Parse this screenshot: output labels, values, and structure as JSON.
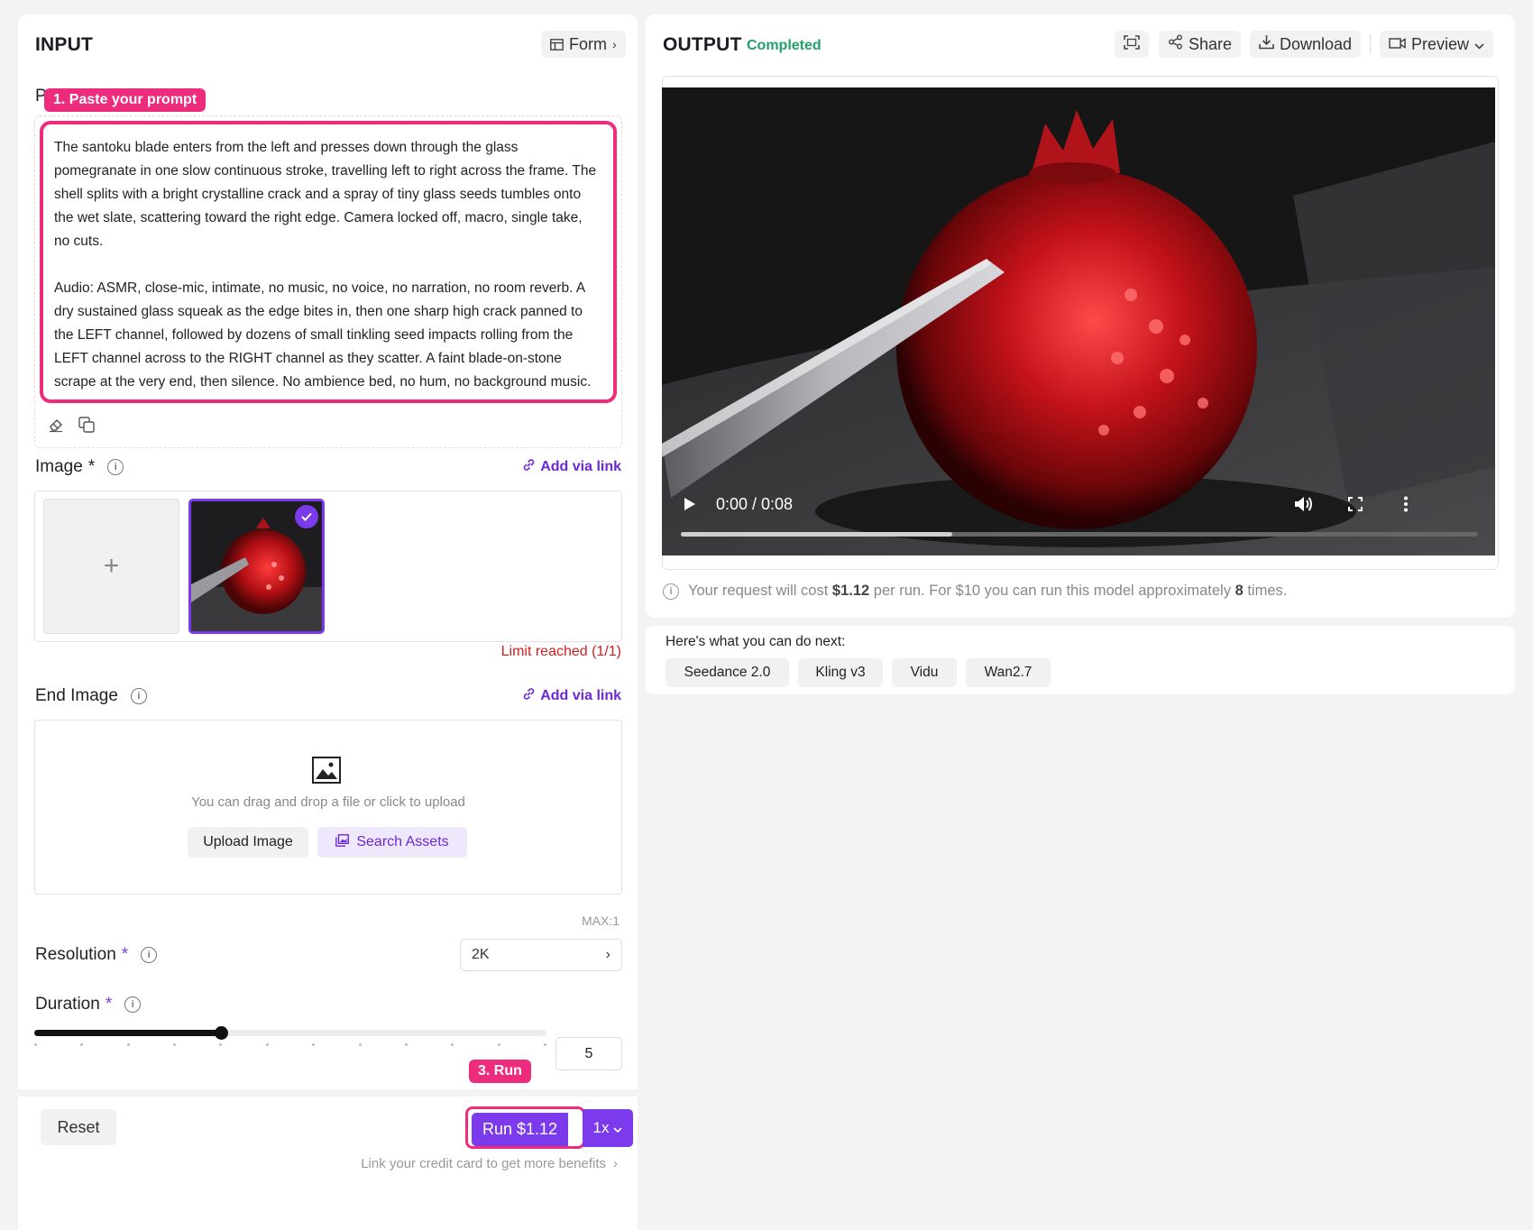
{
  "input": {
    "title": "INPUT",
    "form_button": "Form",
    "prompt_label_initial": "P",
    "prompt_tag": "1. Paste your prompt",
    "prompt_text": "The santoku blade enters from the left and presses down through the glass pomegranate in one slow continuous stroke, travelling left to right across the frame. The shell splits with a bright crystalline crack and a spray of tiny glass seeds tumbles onto the wet slate, scattering toward the right edge. Camera locked off, macro, single take, no cuts.\n\nAudio: ASMR, close-mic, intimate, no music, no voice, no narration, no room reverb. A dry sustained glass squeak as the edge bites in, then one sharp high crack panned to the LEFT channel, followed by dozens of small tinkling seed impacts rolling from the LEFT channel across to the RIGHT channel as they scatter. A faint blade-on-stone scrape at the very end, then silence. No ambience bed, no hum, no background music.",
    "image_label": "Image",
    "image_required": "*",
    "add_via_link": "Add via link",
    "limit_text": "Limit reached (1/1)",
    "end_image_label": "End Image",
    "drop_hint": "You can drag and drop a file or click to upload",
    "upload_button": "Upload Image",
    "search_assets_button": "Search Assets",
    "max_text": "MAX:1",
    "resolution_label": "Resolution",
    "resolution_value": "2K",
    "duration_label": "Duration",
    "duration_value": "5",
    "duration_fraction": 0.364,
    "reset_button": "Reset",
    "run_tag": "3. Run",
    "run_button": "Run $1.12",
    "multiplier": "1x",
    "benefit_text": "Link your credit card to get more benefits"
  },
  "output": {
    "title": "OUTPUT",
    "status": "Completed",
    "share_button": "Share",
    "download_button": "Download",
    "preview_button": "Preview",
    "time": "0:00 / 0:08",
    "progress_fraction": 0.34,
    "cost_prefix": "Your request will cost ",
    "cost_amount": "$1.12",
    "cost_middle": " per run. For $10 you can run this model approximately ",
    "cost_times": "8",
    "cost_suffix": " times."
  },
  "next": {
    "title": "Here's what you can do next:",
    "models": [
      "Seedance 2.0",
      "Kling v3",
      "Vidu",
      "Wan2.7"
    ]
  },
  "colors": {
    "accent": "#7c3aed",
    "highlight": "#ee2c7e",
    "success": "#22a06b",
    "error": "#d21f1f"
  }
}
